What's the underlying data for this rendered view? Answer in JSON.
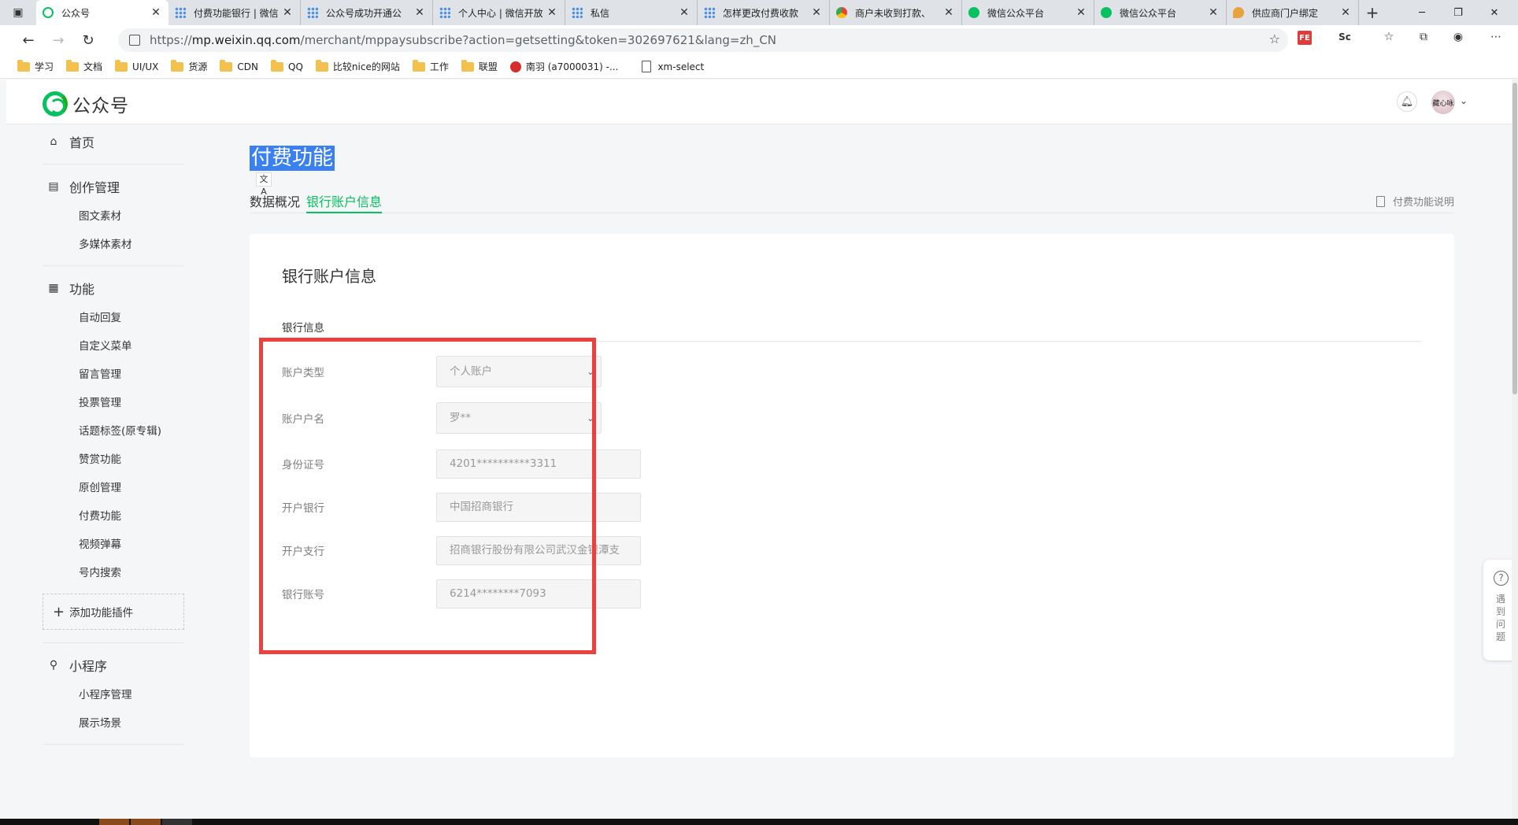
{
  "browser": {
    "tabs": [
      {
        "title": "公众号",
        "favicon": "wechat-mp-logo-icon",
        "active": true
      },
      {
        "title": "付费功能银行 | 微信",
        "favicon": "grid-favicon-icon"
      },
      {
        "title": "公众号成功开通公",
        "favicon": "grid-favicon-icon"
      },
      {
        "title": "个人中心 | 微信开放",
        "favicon": "grid-favicon-icon"
      },
      {
        "title": "私信",
        "favicon": "grid-favicon-icon"
      },
      {
        "title": "怎样更改付费收款",
        "favicon": "grid-favicon-icon"
      },
      {
        "title": "商户未收到打款、",
        "favicon": "chrome-favicon-icon"
      },
      {
        "title": "微信公众平台",
        "favicon": "wechat-favicon-icon"
      },
      {
        "title": "微信公众平台",
        "favicon": "wechat-favicon-icon"
      },
      {
        "title": "供应商门户绑定",
        "favicon": "pin-favicon-icon"
      }
    ],
    "url": {
      "prefix": "https://",
      "host": "mp.weixin.qq.com",
      "path": "/merchant/mppaysubscribe?action=getsetting&token=302697621&lang=zh_CN"
    },
    "extensions": [
      "FE",
      "Sc"
    ],
    "bookmarks": [
      {
        "label": "学习",
        "type": "folder"
      },
      {
        "label": "文档",
        "type": "folder"
      },
      {
        "label": "UI/UX",
        "type": "folder"
      },
      {
        "label": "货源",
        "type": "folder"
      },
      {
        "label": "CDN",
        "type": "folder"
      },
      {
        "label": "QQ",
        "type": "folder"
      },
      {
        "label": "比较nice的网站",
        "type": "folder"
      },
      {
        "label": "工作",
        "type": "folder"
      },
      {
        "label": "联盟",
        "type": "folder"
      },
      {
        "label": "南羽 (a7000031) -...",
        "type": "site"
      },
      {
        "label": "xm-select",
        "type": "doc"
      }
    ]
  },
  "header": {
    "brand": "公众号",
    "avatar_text": "藏心咏"
  },
  "sidebar": {
    "groups": [
      {
        "title": "首页",
        "icon": "home-icon",
        "items": []
      },
      {
        "title": "创作管理",
        "icon": "document-icon",
        "items": [
          "图文素材",
          "多媒体素材"
        ]
      },
      {
        "title": "功能",
        "icon": "grid-icon",
        "items": [
          "自动回复",
          "自定义菜单",
          "留言管理",
          "投票管理",
          "话题标签(原专辑)",
          "赞赏功能",
          "原创管理",
          "付费功能",
          "视频弹幕",
          "号内搜索"
        ],
        "add_plugin": "添加功能插件"
      },
      {
        "title": "小程序",
        "icon": "link-icon",
        "items": [
          "小程序管理",
          "展示场景"
        ]
      }
    ]
  },
  "main": {
    "title": "付费功能",
    "tabs": [
      {
        "label": "数据概况",
        "active": false
      },
      {
        "label": "银行账户信息",
        "active": true
      }
    ],
    "help_link": "付费功能说明",
    "card": {
      "title": "银行账户信息",
      "section": "银行信息",
      "fields": [
        {
          "label": "账户类型",
          "value": "个人账户",
          "kind": "select"
        },
        {
          "label": "账户户名",
          "value": "罗**",
          "kind": "select"
        },
        {
          "label": "身份证号",
          "value": "4201**********3311",
          "kind": "input"
        },
        {
          "label": "开户银行",
          "value": "中国招商银行",
          "kind": "input"
        },
        {
          "label": "开户支行",
          "value": "招商银行股份有限公司武汉金银潭支",
          "kind": "input"
        },
        {
          "label": "银行账号",
          "value": "6214********7093",
          "kind": "input"
        }
      ]
    }
  },
  "feedback": {
    "label": "遇到问题"
  },
  "colors": {
    "accent": "#07c160",
    "highlight_box": "#ef3e3e",
    "selection": "#3a80f0"
  }
}
